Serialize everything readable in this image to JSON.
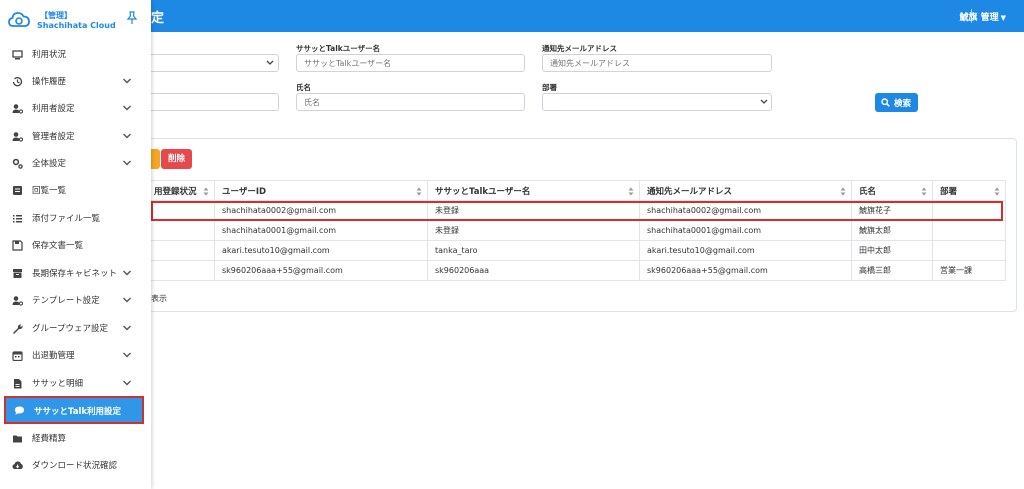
{
  "header": {
    "title": "定",
    "user": "鯱旗 管理",
    "caret": "▼"
  },
  "sidebar": {
    "brand_badge": "【管理】",
    "brand_name": "Shachihata Cloud",
    "items": [
      {
        "label": "利用状況",
        "icon": "monitor-icon",
        "chevron": false
      },
      {
        "label": "操作履歴",
        "icon": "history-icon",
        "chevron": true
      },
      {
        "label": "利用者設定",
        "icon": "user-gear-icon",
        "chevron": true
      },
      {
        "label": "管理者設定",
        "icon": "admin-gear-icon",
        "chevron": true
      },
      {
        "label": "全体設定",
        "icon": "gears-icon",
        "chevron": true
      },
      {
        "label": "回覧一覧",
        "icon": "list-box-icon",
        "chevron": false
      },
      {
        "label": "添付ファイル一覧",
        "icon": "list-icon",
        "chevron": false
      },
      {
        "label": "保存文書一覧",
        "icon": "save-icon",
        "chevron": false
      },
      {
        "label": "長期保存キャビネット",
        "icon": "cabinet-icon",
        "chevron": true
      },
      {
        "label": "テンプレート設定",
        "icon": "template-user-icon",
        "chevron": true
      },
      {
        "label": "グループウェア設定",
        "icon": "wrench-icon",
        "chevron": true
      },
      {
        "label": "出退勤管理",
        "icon": "calendar-icon",
        "chevron": true
      },
      {
        "label": "ササッと明細",
        "icon": "document-icon",
        "chevron": true
      },
      {
        "label": "ササッとTalk利用設定",
        "icon": "chat-icon",
        "chevron": false
      },
      {
        "label": "経費精算",
        "icon": "folder-icon",
        "chevron": false
      },
      {
        "label": "ダウンロード状況確認",
        "icon": "cloud-download-icon",
        "chevron": false
      }
    ]
  },
  "filters": {
    "talk_user_label": "ササッとTalkユーザー名",
    "talk_user_placeholder": "ササッとTalkユーザー名",
    "notify_email_label": "通知先メールアドレス",
    "notify_email_placeholder": "通知先メールアドレス",
    "name_label": "氏名",
    "name_placeholder": "氏名",
    "dept_label": "部署",
    "dept_value": "",
    "search_button": "検索"
  },
  "actions": {
    "delete_button": "削除"
  },
  "table": {
    "columns": [
      "用登録状況",
      "ユーザーID",
      "ササッとTalkユーザー名",
      "通知先メールアドレス",
      "氏名",
      "部署"
    ],
    "rows": [
      [
        "",
        "shachihata0002@gmail.com",
        "未登録",
        "shachihata0002@gmail.com",
        "鯱旗花子",
        ""
      ],
      [
        "",
        "shachihata0001@gmail.com",
        "未登録",
        "shachihata0001@gmail.com",
        "鯱旗太郎",
        ""
      ],
      [
        "",
        "akari.tesuto10@gmail.com",
        "tanka_taro",
        "akari.tesuto10@gmail.com",
        "田中太郎",
        ""
      ],
      [
        "",
        "sk960206aaa+55@gmail.com",
        "sk960206aaa",
        "sk960206aaa+55@gmail.com",
        "高橋三郎",
        "営業一課"
      ]
    ],
    "footer_text": "表示"
  },
  "colors": {
    "primary": "#1e88e5",
    "danger": "#e5484d",
    "warning": "#f5a623",
    "highlight": "#d32f2f"
  }
}
